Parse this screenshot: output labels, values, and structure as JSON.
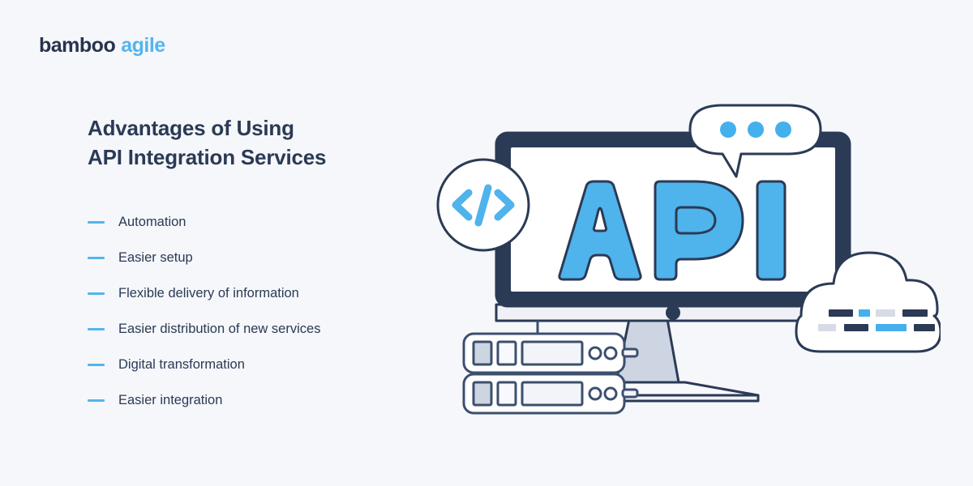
{
  "background_color": "#f5f7fa",
  "brand": {
    "logo_primary": "bamboo",
    "logo_secondary": "agile",
    "primary_color": "#28334d",
    "accent_color": "#55b4ed"
  },
  "heading": {
    "line1": "Advantages of Using",
    "line2": "API Integration Services",
    "color": "#2b3a55"
  },
  "bullets": [
    {
      "label": "Automation"
    },
    {
      "label": "Easier setup"
    },
    {
      "label": "Flexible delivery of information"
    },
    {
      "label": "Easier distribution of new services"
    },
    {
      "label": "Digital transformation"
    },
    {
      "label": "Easier integration"
    }
  ],
  "illustration": {
    "screen_text": "API",
    "code_badge_text": "</>",
    "colors": {
      "navy": "#2b3a55",
      "blue": "#4fb3ec",
      "light_gray": "#eff1f6",
      "mid_gray": "#cdd5e3",
      "white": "#ffffff",
      "stroke_gray": "#3c4f6e"
    },
    "speech_bubble_dots": 3,
    "cloud_code_row1": [
      "navy",
      "blue",
      "light_gray",
      "navy"
    ],
    "cloud_code_row2": [
      "light_gray",
      "navy",
      "blue",
      "navy"
    ],
    "servers": 2,
    "server_indicator_circles": 2
  }
}
